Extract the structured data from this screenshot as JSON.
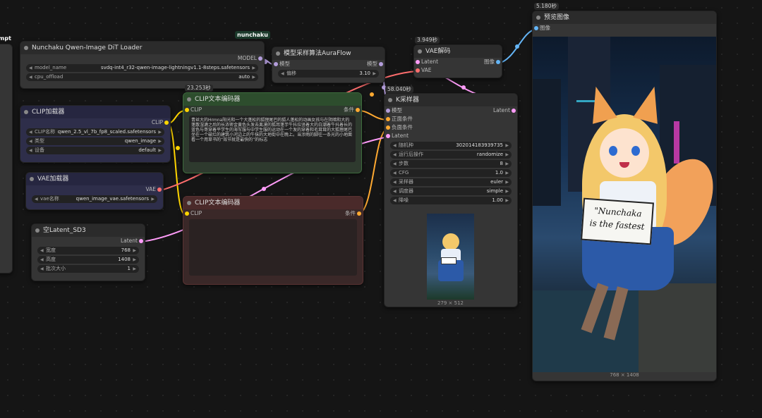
{
  "colors": {
    "model": "#b39ddb",
    "clip": "#ffd500",
    "latent": "#ff9cf9",
    "vae": "#ff6e6e",
    "conditioning": "#ffa931",
    "image": "#64b5f6"
  },
  "left_stub": {
    "title": "mpt"
  },
  "badge_nunchaku": "nunchaku",
  "dit_loader": {
    "title": "Nunchaku Qwen-Image DiT Loader",
    "output": "MODEL",
    "widgets": [
      {
        "name": "model_name",
        "value": "svdq-int4_r32-qwen-image-lightningv1.1-8steps.safetensors"
      },
      {
        "name": "cpu_offload",
        "value": "auto"
      }
    ]
  },
  "clip_loader": {
    "title": "CLIP加载器",
    "output": "CLIP",
    "widgets": [
      {
        "name": "CLIP名称",
        "value": "qwen_2.5_vl_7b_fp8_scaled.safetensors"
      },
      {
        "name": "类型",
        "value": "qwen_image"
      },
      {
        "name": "设备",
        "value": "default"
      }
    ]
  },
  "vae_loader": {
    "title": "VAE加载器",
    "output": "VAE",
    "widgets": [
      {
        "name": "vae名称",
        "value": "qwen_image_vae.safetensors"
      }
    ]
  },
  "latent": {
    "title": "空Latent_SD3",
    "output": "Latent",
    "widgets": [
      {
        "name": "宽度",
        "value": "768"
      },
      {
        "name": "高度",
        "value": "1408"
      },
      {
        "name": "批次大小",
        "value": "1"
      }
    ]
  },
  "clip_pos": {
    "time": "23.253秒",
    "title": "CLIP文本编码器",
    "input": "CLIP",
    "output": "条件",
    "text": "青丝大的Hrmna阳光和一个大蓬松的狐狸尾巴的狐人蓬松的动画女孩与在阴暗和大的蓬散湿漉之后的长浓密金黄色头发去离漠的狐耳蓬芋牛抖拉竖着大的白潮着牛抖着长的蓝色与哥穿着平学生的海军服与中学生服的运动在一个发的穿着和毛茸茸的大狐狸尾巴坐在一个破烂的建筑小河边上的牛抹的大地街中在晚上。当涉雨的脚往一条光的小地面看一个用草书的“效节就是最快的”的标志"
  },
  "clip_neg": {
    "title": "CLIP文本编码器",
    "input": "CLIP",
    "output": "条件"
  },
  "sampling": {
    "title": "模型采样算法AuraFlow",
    "input": "模型",
    "output": "模型",
    "widgets": [
      {
        "name": "偏移",
        "value": "3.10"
      }
    ]
  },
  "vae_decode": {
    "time": "3.949秒",
    "title": "VAE解码",
    "inputs": [
      "Latent",
      "VAE"
    ],
    "output": "图像"
  },
  "ksampler": {
    "time": "58.040秒",
    "title": "K采样器",
    "inputs": [
      "模型",
      "正面条件",
      "负面条件",
      "Latent"
    ],
    "output": "Latent",
    "widgets": [
      {
        "name": "随机种",
        "value": "302014183939735"
      },
      {
        "name": "运行后操作",
        "value": "randomize"
      },
      {
        "name": "步数",
        "value": "8"
      },
      {
        "name": "CFG",
        "value": "1.0"
      },
      {
        "name": "采样器",
        "value": "euler"
      },
      {
        "name": "调度器",
        "value": "simple"
      },
      {
        "name": "降噪",
        "value": "1.00"
      }
    ],
    "preview_size": "279 × 512"
  },
  "preview": {
    "time": "5.180秒",
    "title": "预览图像",
    "input": "图像",
    "sign_line1": "\"Nunchaka",
    "sign_line2": "is the fastest",
    "size": "768 × 1408"
  }
}
